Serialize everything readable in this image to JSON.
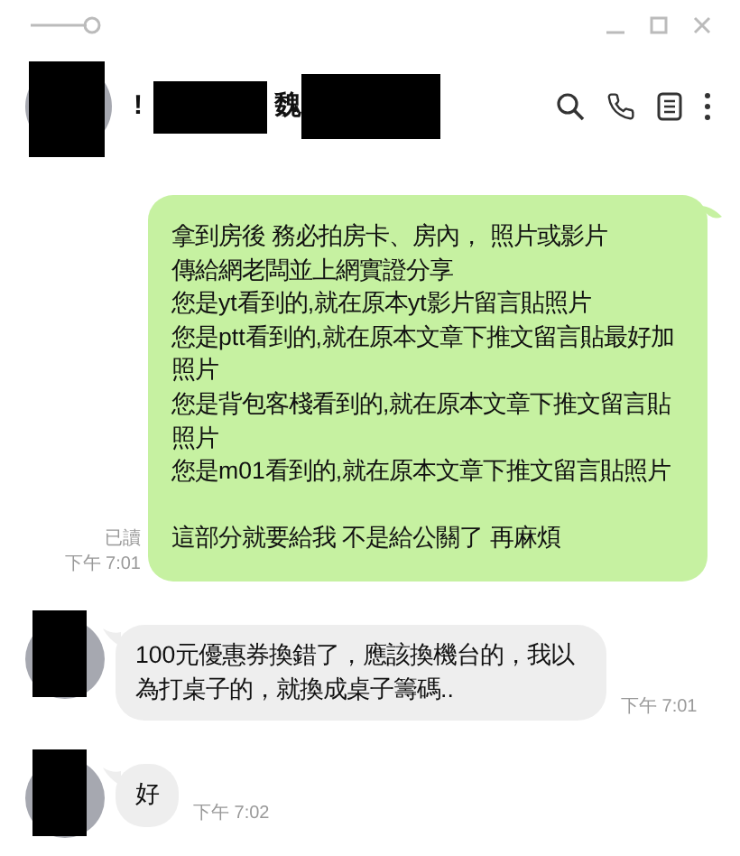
{
  "header": {
    "title_parts": [
      "!",
      "魏"
    ]
  },
  "messages": [
    {
      "kind": "outgoing",
      "paragraphs": [
        [
          "拿到房後 務必拍房卡、房內， 照片或影片",
          "傳給網老闆並上網實證分享",
          "您是yt看到的,就在原本yt影片留言貼照片",
          "您是ptt看到的,就在原本文章下推文留言貼最好加照片",
          "您是背包客棧看到的,就在原本文章下推文留言貼照片",
          "您是m01看到的,就在原本文章下推文留言貼照片"
        ],
        [
          "這部分就要給我  不是給公關了  再麻煩"
        ]
      ],
      "read": "已讀",
      "time": "下午 7:01"
    },
    {
      "kind": "incoming",
      "text": "100元優惠券換錯了，應該換機台的，我以為打桌子的，就換成桌子籌碼..",
      "time": "下午 7:01"
    },
    {
      "kind": "incoming",
      "text": "好",
      "time": "下午 7:02"
    }
  ]
}
